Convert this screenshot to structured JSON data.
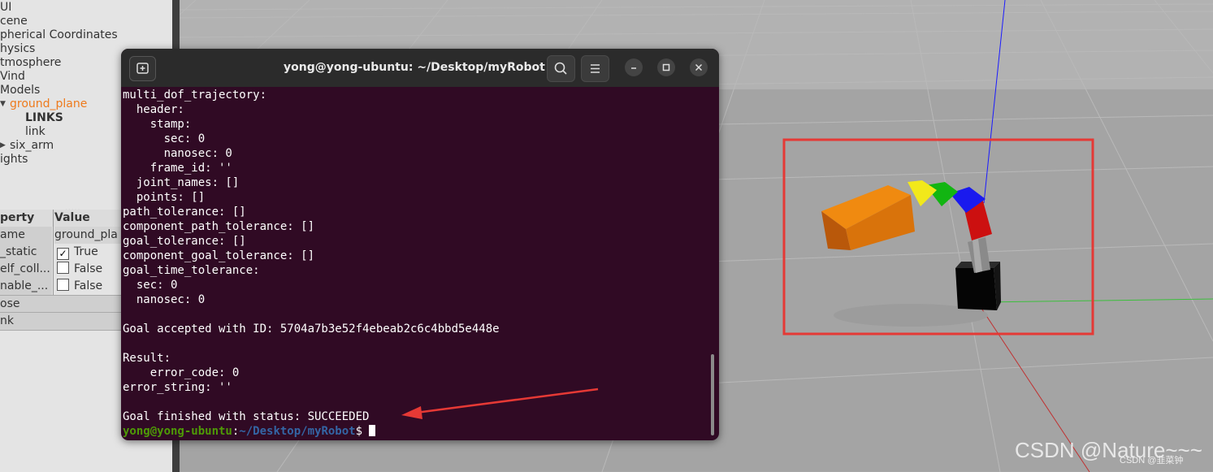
{
  "tree": [
    {
      "label": "UI"
    },
    {
      "label": "cene"
    },
    {
      "label": "pherical Coordinates"
    },
    {
      "label": "hysics"
    },
    {
      "label": "tmosphere"
    },
    {
      "label": "Vind"
    },
    {
      "label": "Models"
    },
    {
      "label": "ground_plane"
    },
    {
      "label": "LINKS"
    },
    {
      "label": "link"
    },
    {
      "label": "six_arm"
    },
    {
      "label": "ights"
    }
  ],
  "splitter_dots": ".....",
  "properties": {
    "header": {
      "property": "perty",
      "value": "Value"
    },
    "rows": [
      {
        "name": "ame",
        "value": "ground_pla"
      },
      {
        "name": "_static",
        "value": "True",
        "checked": true
      },
      {
        "name": "elf_coll...",
        "value": "False",
        "checked": false
      },
      {
        "name": "nable_...",
        "value": "False",
        "checked": false
      },
      {
        "name": "ose",
        "value": ""
      },
      {
        "name": "nk",
        "value": ""
      }
    ]
  },
  "terminal": {
    "title": "yong@yong-ubuntu: ~/Desktop/myRobot",
    "lines": [
      "multi_dof_trajectory:",
      "  header:",
      "    stamp:",
      "      sec: 0",
      "      nanosec: 0",
      "    frame_id: ''",
      "  joint_names: []",
      "  points: []",
      "path_tolerance: []",
      "component_path_tolerance: []",
      "goal_tolerance: []",
      "component_goal_tolerance: []",
      "goal_time_tolerance:",
      "  sec: 0",
      "  nanosec: 0",
      "",
      "Goal accepted with ID: 5704a7b3e52f4ebeab2c6c4bbd5e448e",
      "",
      "Result:",
      "    error_code: 0",
      "error_string: ''",
      "",
      "Goal finished with status: SUCCEEDED"
    ],
    "prompt_user": "yong@yong-ubuntu",
    "prompt_sep": ":",
    "prompt_path": "~/Desktop/myRobot",
    "prompt_end": "$"
  },
  "watermark": "CSDN @Nature~~~",
  "watermark_small": "CSDN @韭菜钟",
  "colors": {
    "terminal_bg": "#300a24",
    "highlight_box": "#e53935",
    "arrow": "#e53935"
  },
  "icons": [
    "new-tab-icon",
    "search-icon",
    "menu-icon",
    "minimize-icon",
    "maximize-icon",
    "close-icon"
  ]
}
